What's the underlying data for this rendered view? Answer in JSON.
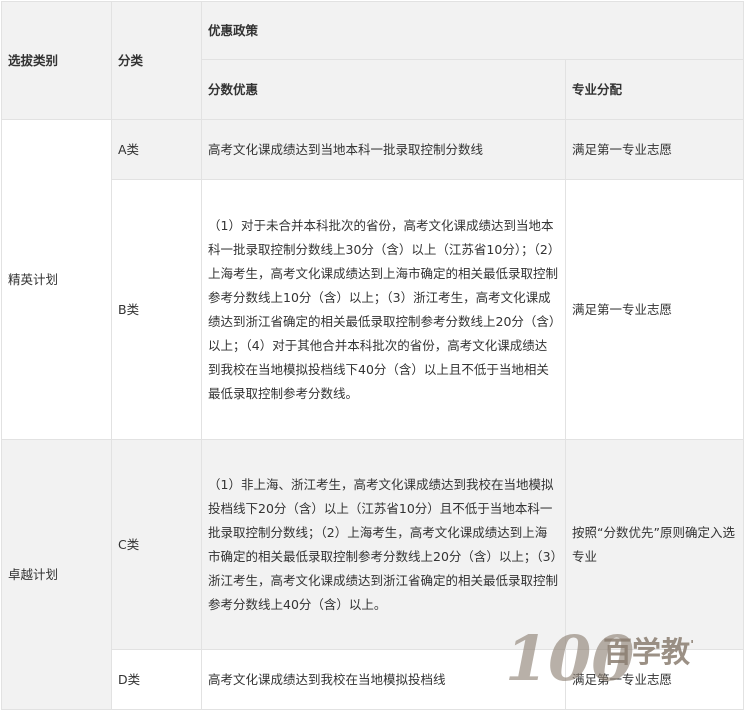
{
  "table": {
    "header": {
      "category": "选拔类别",
      "class": "分类",
      "policy": "优惠政策",
      "score_policy": "分数优惠",
      "major_policy": "专业分配"
    },
    "plans": [
      {
        "name": "精英计划",
        "rows": [
          {
            "class": "A类",
            "score": "高考文化课成绩达到当地本科一批录取控制分数线",
            "major": "满足第一专业志愿"
          },
          {
            "class": "B类",
            "score": "（1）对于未合并本科批次的省份，高考文化课成绩达到当地本科一批录取控制分数线上30分（含）以上（江苏省10分）；（2）上海考生，高考文化课成绩达到上海市确定的相关最低录取控制参考分数线上10分（含）以上；（3）浙江考生，高考文化课成绩达到浙江省确定的相关最低录取控制参考分数线上20分（含）以上；（4）对于其他合并本科批次的省份，高考文化课成绩达到我校在当地模拟投档线下40分（含）以上且不低于当地相关最低录取控制参考分数线。",
            "major": "满足第一专业志愿"
          }
        ]
      },
      {
        "name": "卓越计划",
        "rows": [
          {
            "class": "C类",
            "score": "（1）非上海、浙江考生，高考文化课成绩达到我校在当地模拟投档线下20分（含）以上（江苏省10分）且不低于当地本科一批录取控制分数线；（2）上海考生，高考文化课成绩达到上海市确定的相关最低录取控制参考分数线上20分（含）以上；（3）浙江考生，高考文化课成绩达到浙江省确定的相关最低录取控制参考分数线上40分（含）以上。",
            "major": "按照“分数优先”原则确定入选专业"
          },
          {
            "class": "D类",
            "score": "高考文化课成绩达到我校在当地模拟投档线",
            "major": "满足第一专业志愿"
          }
        ]
      }
    ]
  },
  "watermark": {
    "number": "100",
    "brand": "百学教育"
  }
}
